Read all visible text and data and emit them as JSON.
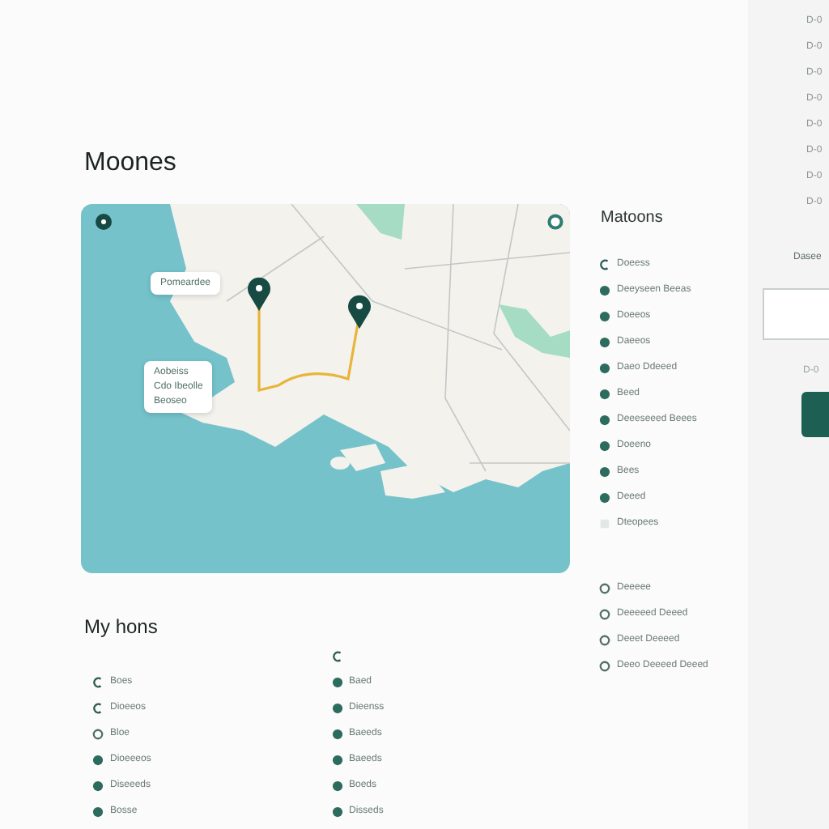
{
  "title": "Moones",
  "map": {
    "callouts": [
      {
        "lines": [
          "Pomeardee"
        ]
      },
      {
        "lines": [
          "Aobeiss",
          "Cdo Ibeolle",
          "Beoseo"
        ]
      }
    ]
  },
  "lists_title": "My hons",
  "columns": [
    {
      "items": [
        {
          "kind": "chevron",
          "label": "Boes"
        },
        {
          "kind": "chevron",
          "label": "Dioeeos"
        },
        {
          "kind": "ring",
          "label": "Bloe"
        },
        {
          "kind": "dot",
          "label": "Dioeeeos"
        },
        {
          "kind": "dot",
          "label": "Diseeeds"
        },
        {
          "kind": "dot",
          "label": "Bosse"
        }
      ]
    },
    {
      "items": [
        {
          "kind": "chevron"
        },
        {
          "kind": "dot",
          "label": "Baed"
        },
        {
          "kind": "dot",
          "label": "Dieenss"
        },
        {
          "kind": "dot",
          "label": "Baeeds"
        },
        {
          "kind": "dot",
          "label": "Baeeds"
        },
        {
          "kind": "dot",
          "label": "Boeds"
        },
        {
          "kind": "dot",
          "label": "Disseds"
        }
      ]
    }
  ],
  "places": {
    "title": "Matoons",
    "items": [
      {
        "kind": "chevron",
        "label": "Doeess"
      },
      {
        "kind": "dot",
        "label": "Deeyseen Beeas"
      },
      {
        "kind": "dot",
        "label": "Doeeos"
      },
      {
        "kind": "dot",
        "label": "Daeeos"
      },
      {
        "kind": "dot",
        "label": "Daeo Ddeeed"
      },
      {
        "kind": "dot",
        "label": "Beed"
      },
      {
        "kind": "dot",
        "label": "Deeeseeed Beees"
      },
      {
        "kind": "dot",
        "label": "Doeeno"
      },
      {
        "kind": "dot",
        "label": "Bees"
      },
      {
        "kind": "dot",
        "label": "Deeed"
      },
      {
        "kind": "faint",
        "label": "Dteopees"
      }
    ],
    "more": [
      {
        "kind": "ring",
        "label": "Deeeee"
      },
      {
        "kind": "ring",
        "label": "Deeeeed Deeed"
      },
      {
        "kind": "ring",
        "label": "Deeet Deeeed"
      },
      {
        "kind": "ring",
        "label": "Deeo Deeeed Deeed"
      }
    ]
  },
  "strip": {
    "labels": [
      "D-0",
      "D-0",
      "D-0",
      "D-0",
      "D-0",
      "D-0",
      "D-0",
      "D-0"
    ],
    "field_label": "Dasee",
    "note": "D-0"
  }
}
